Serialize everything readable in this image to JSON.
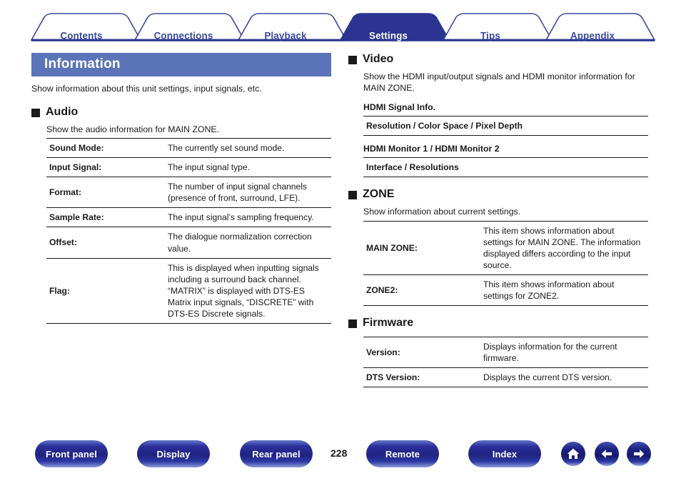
{
  "tabs": [
    {
      "label": "Contents",
      "active": false
    },
    {
      "label": "Connections",
      "active": false
    },
    {
      "label": "Playback",
      "active": false
    },
    {
      "label": "Settings",
      "active": true
    },
    {
      "label": "Tips",
      "active": false
    },
    {
      "label": "Appendix",
      "active": false
    }
  ],
  "page": {
    "title": "Information",
    "intro": "Show information about this unit settings, input signals, etc.",
    "number": "228"
  },
  "sections": {
    "audio": {
      "heading": "Audio",
      "description": "Show the audio information for MAIN ZONE.",
      "rows": [
        {
          "key": "Sound Mode:",
          "value": "The currently set sound mode."
        },
        {
          "key": "Input Signal:",
          "value": "The input signal type."
        },
        {
          "key": "Format:",
          "value": "The number of input signal channels (presence of front, surround, LFE)."
        },
        {
          "key": "Sample Rate:",
          "value": "The input signal’s sampling frequency."
        },
        {
          "key": "Offset:",
          "value": "The dialogue normalization correction value."
        },
        {
          "key": "Flag:",
          "value": "This is displayed when inputting signals including a surround back channel. “MATRIX” is displayed with DTS-ES Matrix input signals, “DISCRETE” with DTS-ES Discrete signals."
        }
      ]
    },
    "video": {
      "heading": "Video",
      "description": "Show the HDMI input/output signals and HDMI monitor information for MAIN ZONE.",
      "groups": [
        {
          "label": "HDMI Signal Info.",
          "row": "Resolution / Color Space / Pixel Depth"
        },
        {
          "label": "HDMI Monitor 1 / HDMI Monitor 2",
          "row": "Interface / Resolutions"
        }
      ]
    },
    "zone": {
      "heading": "ZONE",
      "description": "Show information about current settings.",
      "rows": [
        {
          "key": "MAIN ZONE:",
          "value": "This item shows information about settings for MAIN ZONE. The information displayed differs according to the input source."
        },
        {
          "key": "ZONE2:",
          "value": "This item shows information about settings for ZONE2."
        }
      ]
    },
    "firmware": {
      "heading": "Firmware",
      "rows": [
        {
          "key": "Version:",
          "value": "Displays information for the current firmware."
        },
        {
          "key": "DTS Version:",
          "value": "Displays the current DTS version."
        }
      ]
    }
  },
  "footer": {
    "buttons": [
      {
        "label": "Front panel"
      },
      {
        "label": "Display"
      },
      {
        "label": "Rear panel"
      },
      {
        "label": "Remote"
      },
      {
        "label": "Index"
      }
    ],
    "icons": [
      {
        "name": "home-icon"
      },
      {
        "name": "arrow-left-icon"
      },
      {
        "name": "arrow-right-icon"
      }
    ]
  },
  "colors": {
    "tab_active_bg": "#2b3490",
    "tab_border": "#3a4a9e",
    "title_bar_bg": "#5b74b8",
    "button_blue": "#2b2f99"
  }
}
